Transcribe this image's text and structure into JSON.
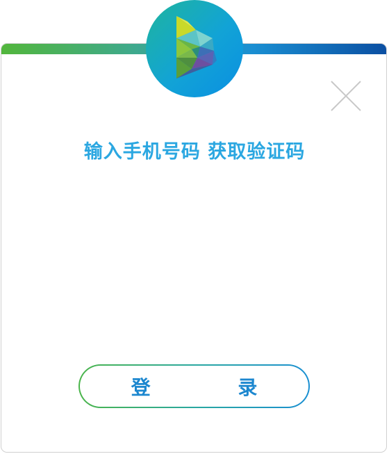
{
  "dialog": {
    "title": "输入手机号码 获取验证码",
    "login_label": "登 录"
  },
  "icons": {
    "logo": "brand-logo-icon",
    "close": "close-icon"
  },
  "colors": {
    "title": "#2ba7e1",
    "login_text": "#1c87cf",
    "bar_start": "#52b63c",
    "bar_end": "#0b4fa2",
    "logo_bg": "#12a3d6"
  }
}
